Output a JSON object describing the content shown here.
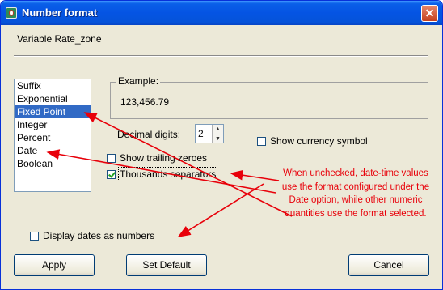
{
  "window": {
    "title": "Number format",
    "icon": "app-icon",
    "close_icon": "close-icon"
  },
  "variable_label": "Variable Rate_zone",
  "format_list": {
    "items": [
      "Suffix",
      "Exponential",
      "Fixed Point",
      "Integer",
      "Percent",
      "Date",
      "Boolean"
    ],
    "selected": "Fixed Point"
  },
  "example": {
    "label": "Example:",
    "value": "123,456.79"
  },
  "decimal_digits": {
    "label": "Decimal digits:",
    "value": "2"
  },
  "options": {
    "show_currency": {
      "label": "Show currency symbol",
      "checked": false
    },
    "show_trailing_zeroes": {
      "label": "Show trailing zeroes",
      "checked": false
    },
    "thousands_separators": {
      "label": "Thousands separators",
      "checked": true
    },
    "display_dates_as_numbers": {
      "label": "Display dates as numbers",
      "checked": false
    }
  },
  "buttons": {
    "apply": "Apply",
    "set_default": "Set Default",
    "cancel": "Cancel"
  },
  "annotation": {
    "text": "When unchecked, date-time values use the format configured under the Date option, while other numeric quantities use the format selected.",
    "color": "#e8000a"
  },
  "colors": {
    "selection": "#316ac5",
    "dialog_bg": "#ece9d8",
    "titlebar": "#0554e3"
  }
}
